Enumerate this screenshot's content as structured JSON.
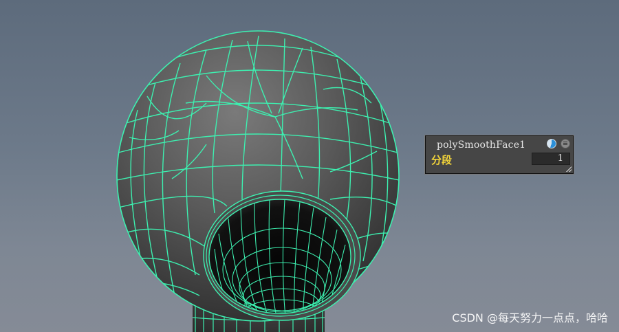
{
  "viewport": {
    "background_top": "#5d6b7c",
    "background_bottom": "#858b96",
    "mesh_color": "#3df0b0",
    "mesh_fill": "#4a4a4a"
  },
  "hud": {
    "node_name": "polySmoothFace1",
    "display_icon": "display-mode-icon",
    "menu_icon": "menu-icon",
    "attribute": {
      "label": "分段",
      "value": "1"
    }
  },
  "watermark": "CSDN @每天努力一点点，哈哈"
}
